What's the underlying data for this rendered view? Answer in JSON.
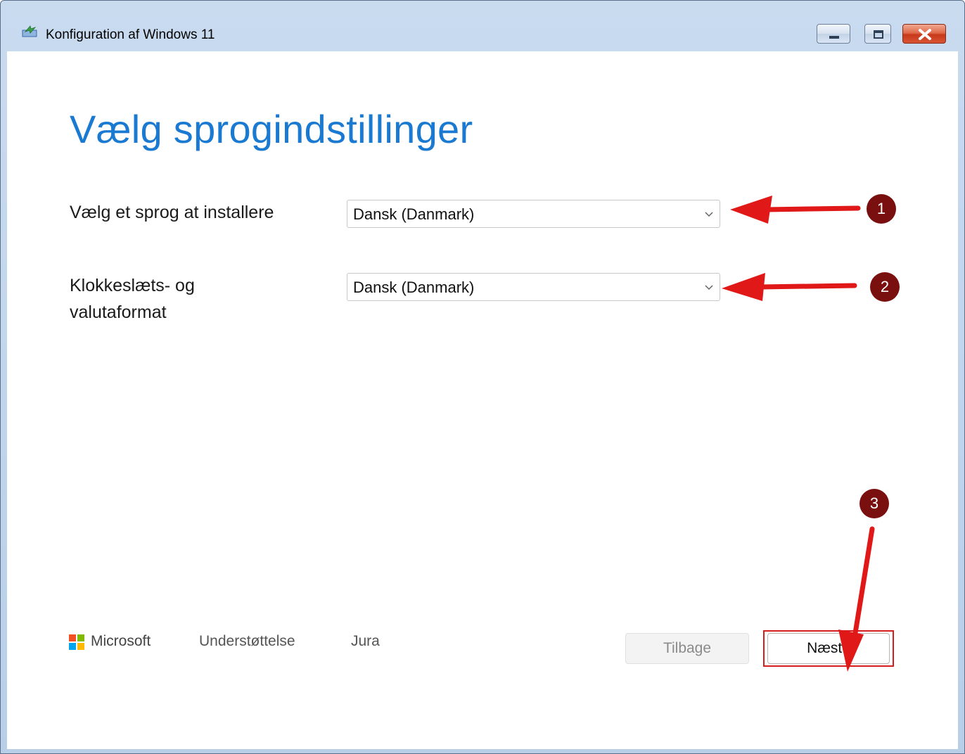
{
  "window": {
    "title": "Konfiguration af Windows 11"
  },
  "controls": {
    "minimize": "minimize",
    "maximize": "maximize",
    "close": "close"
  },
  "page": {
    "heading": "Vælg sprogindstillinger"
  },
  "form": {
    "language_label": "Vælg et sprog at installere",
    "language_value": "Dansk (Danmark)",
    "format_label_line1": "Klokkeslæts- og",
    "format_label_line2": "valutaformat",
    "format_value": "Dansk (Danmark)"
  },
  "footer": {
    "brand": "Microsoft",
    "support_link": "Understøttelse",
    "legal_link": "Jura",
    "back_button": "Tilbage",
    "next_button": "Næste"
  },
  "annotations": {
    "badge1": "1",
    "badge2": "2",
    "badge3": "3"
  },
  "colors": {
    "accent": "#1a7ad1",
    "annotation_red": "#e01818",
    "badge": "#7a0f0f"
  }
}
